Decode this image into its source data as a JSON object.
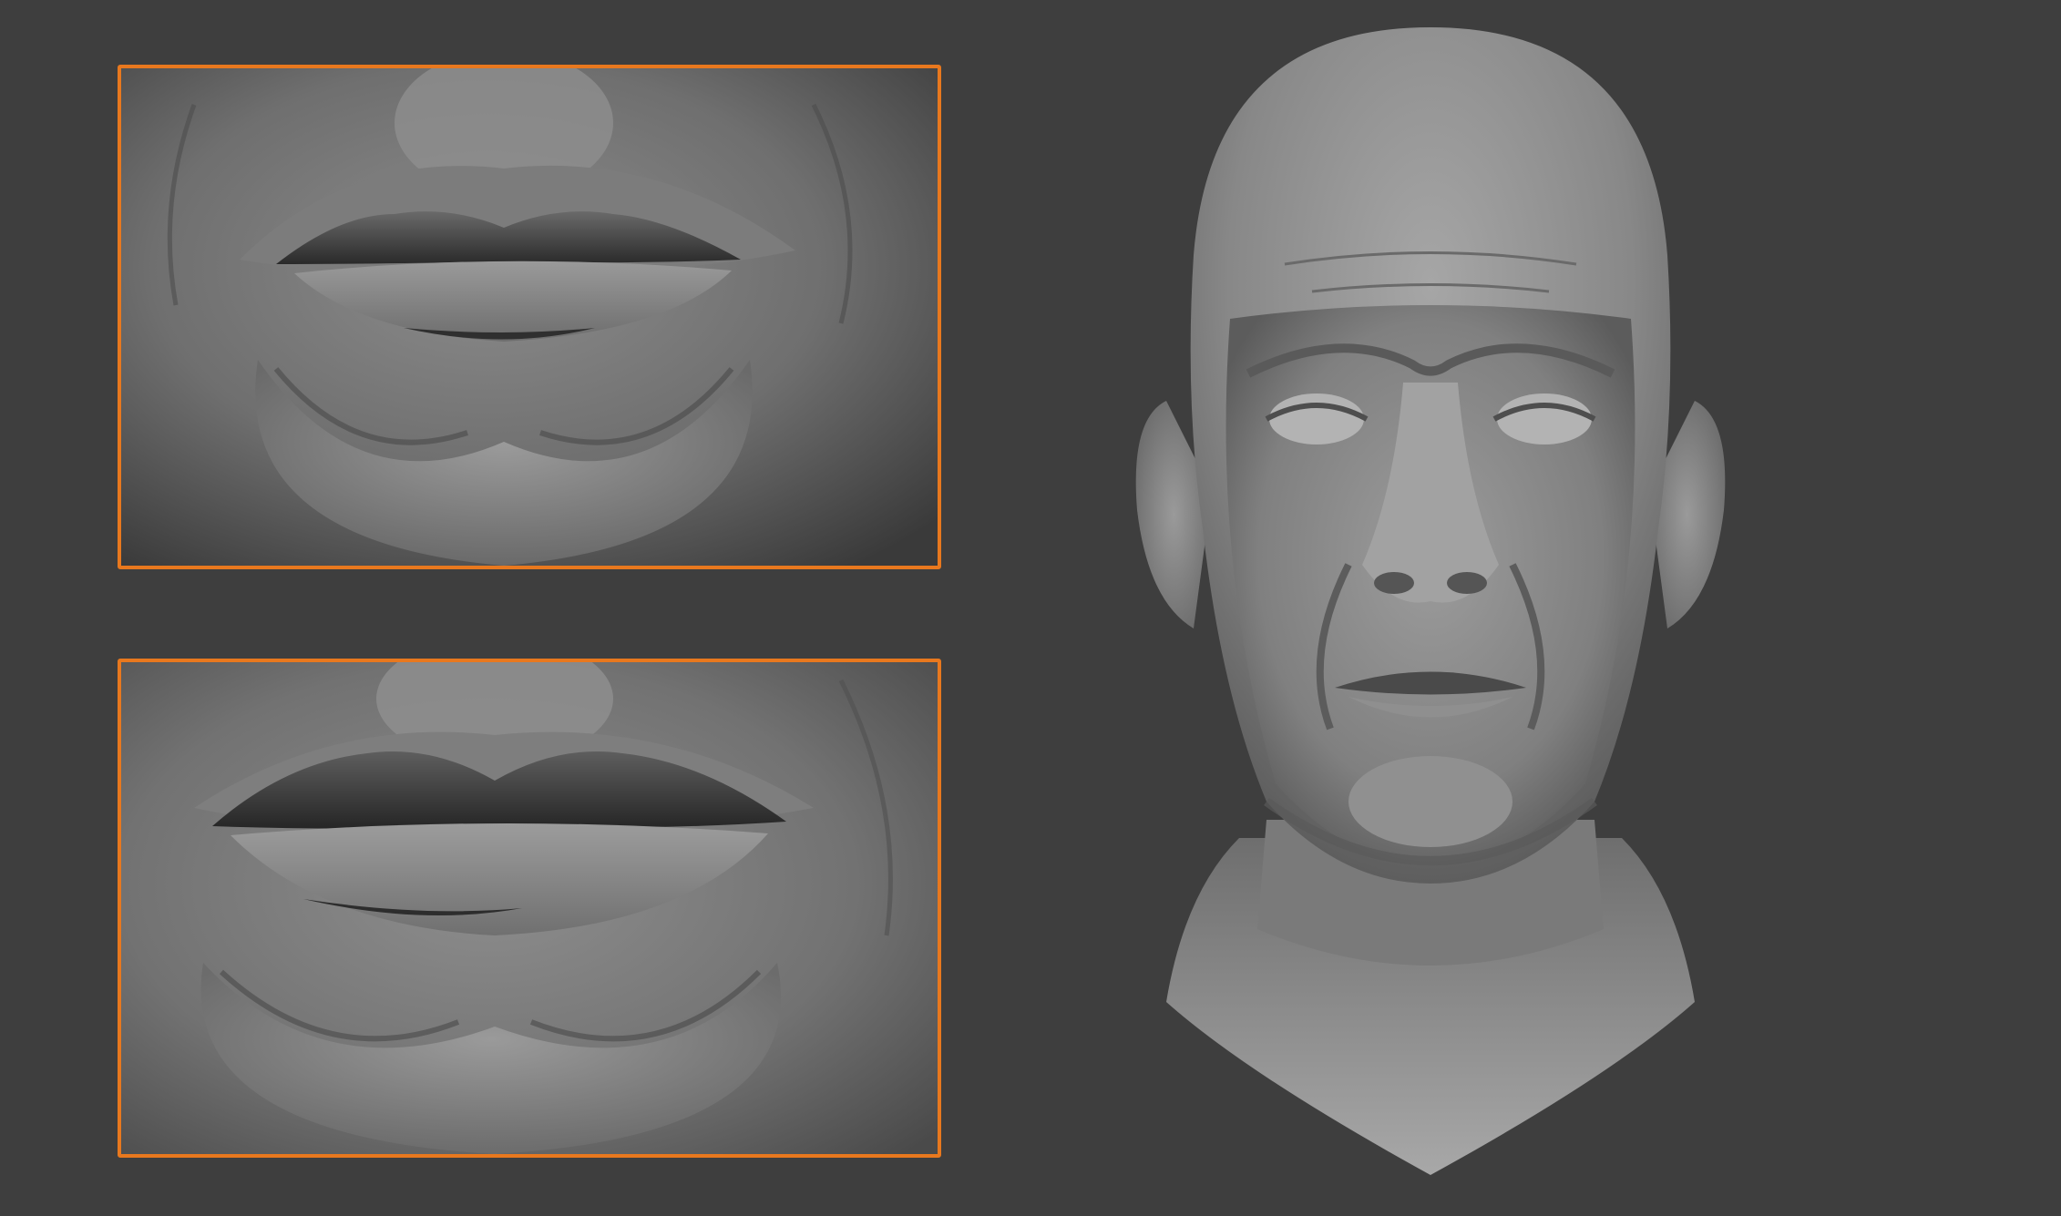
{
  "image": {
    "background_color": "#3e3e3e",
    "accent_color": "#e8781e",
    "clay_color": "#8a8a8a"
  },
  "panels": [
    {
      "name": "closeup-top",
      "subject": "lips-detail",
      "border_color": "#e8781e"
    },
    {
      "name": "closeup-bottom",
      "subject": "lips-detail",
      "border_color": "#e8781e"
    }
  ],
  "main_subject": {
    "name": "sculpted-head-bust"
  }
}
